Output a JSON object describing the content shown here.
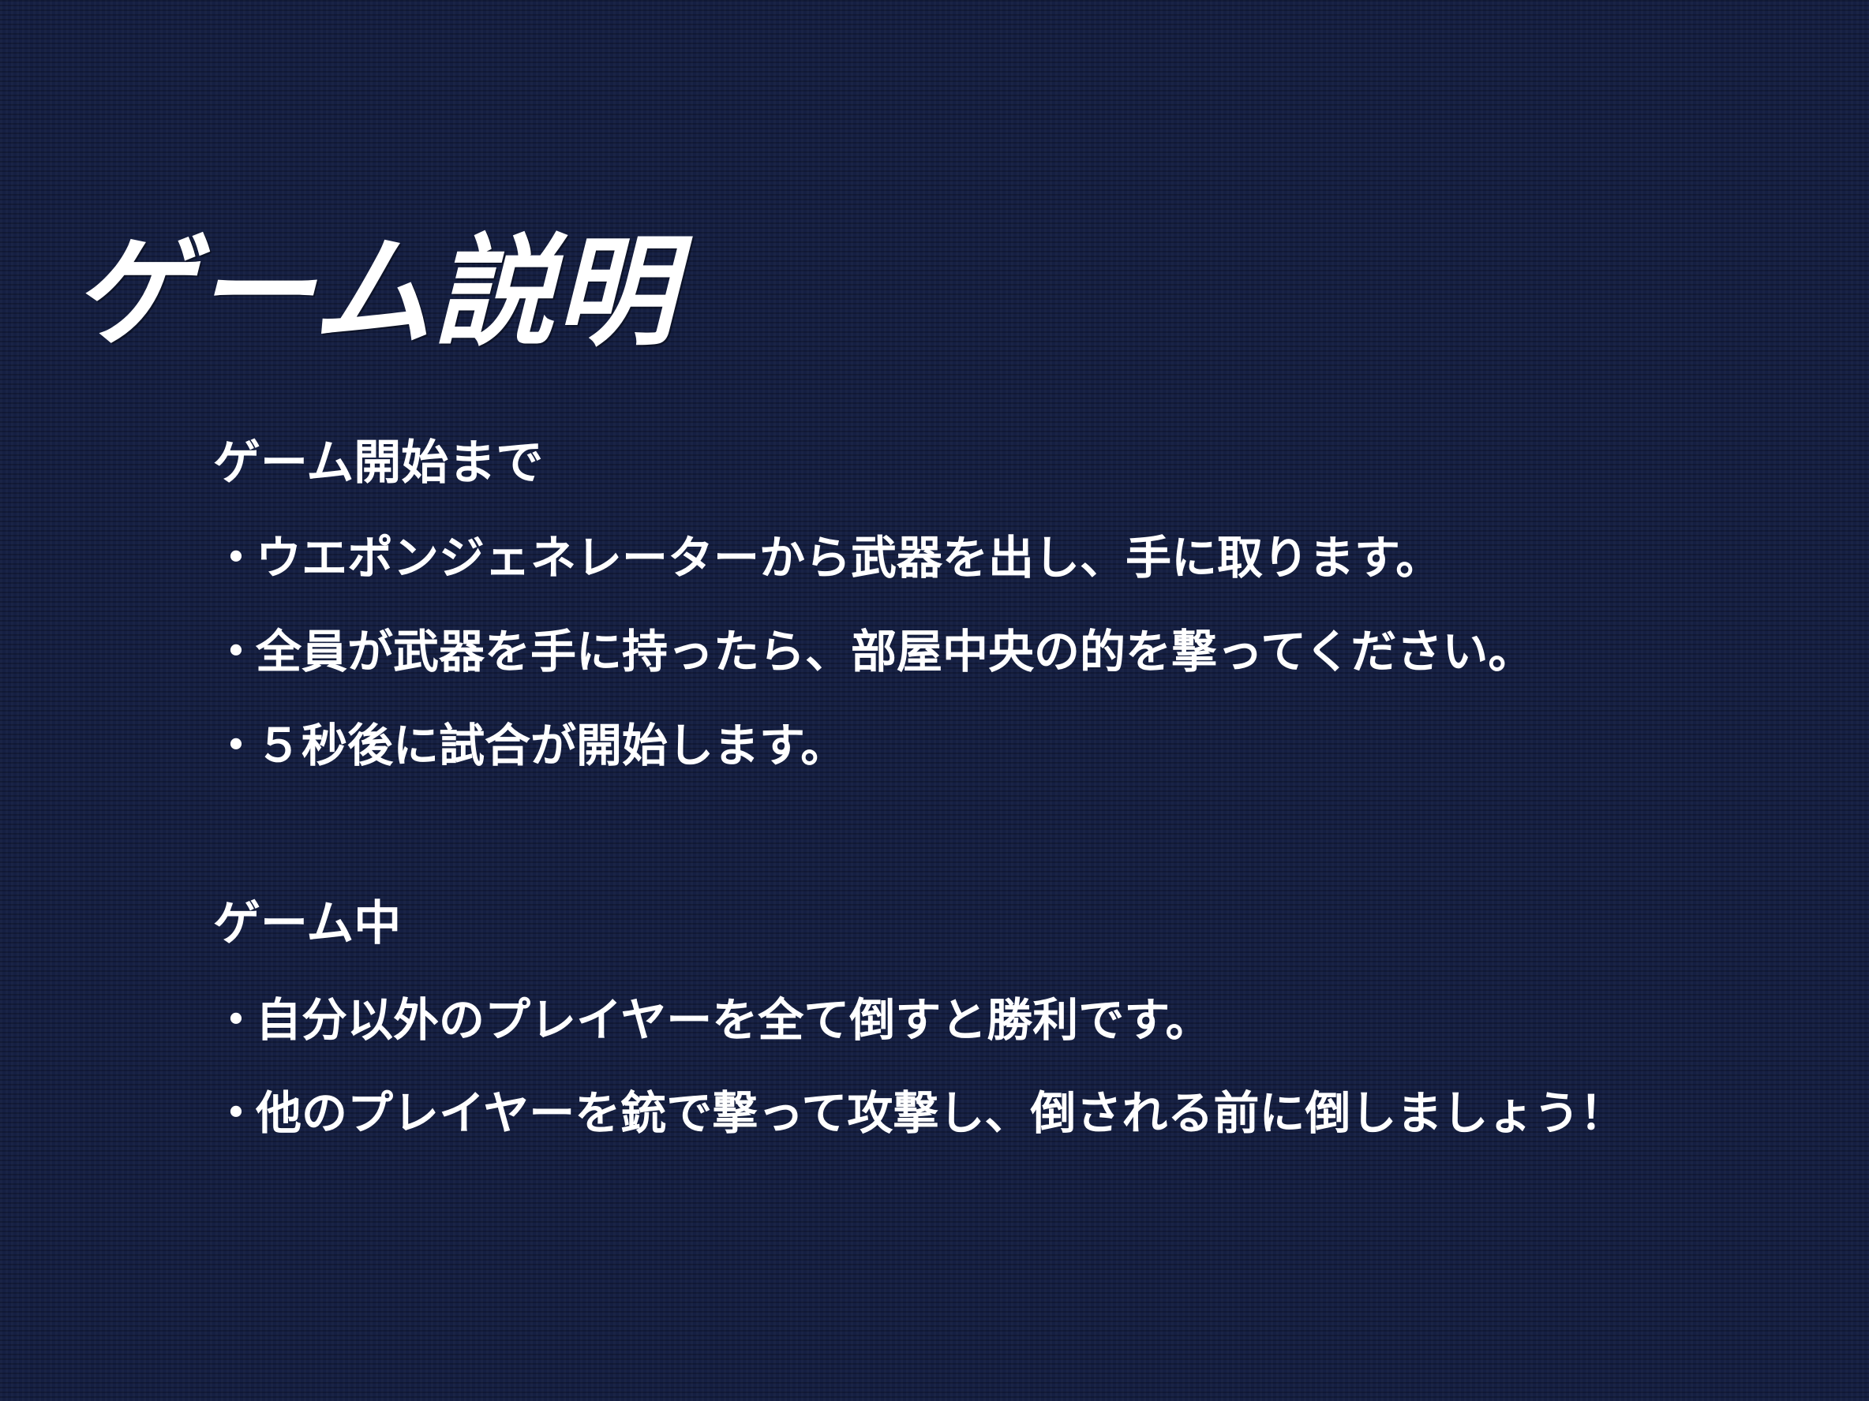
{
  "title": "ゲーム説明",
  "sections": [
    {
      "heading": "ゲーム開始まで",
      "bullets": [
        "ウエポンジェネレーターから武器を出し、手に取ります。",
        "全員が武器を手に持ったら、部屋中央の的を撃ってください。",
        "５秒後に試合が開始します。"
      ]
    },
    {
      "heading": "ゲーム中",
      "bullets": [
        "自分以外のプレイヤーを全て倒すと勝利です。",
        "他のプレイヤーを銃で撃って攻撃し、倒される前に倒しましょう！"
      ]
    }
  ],
  "bullet_symbol": "・",
  "colors": {
    "background": "#151f42",
    "text": "#ffffff"
  }
}
